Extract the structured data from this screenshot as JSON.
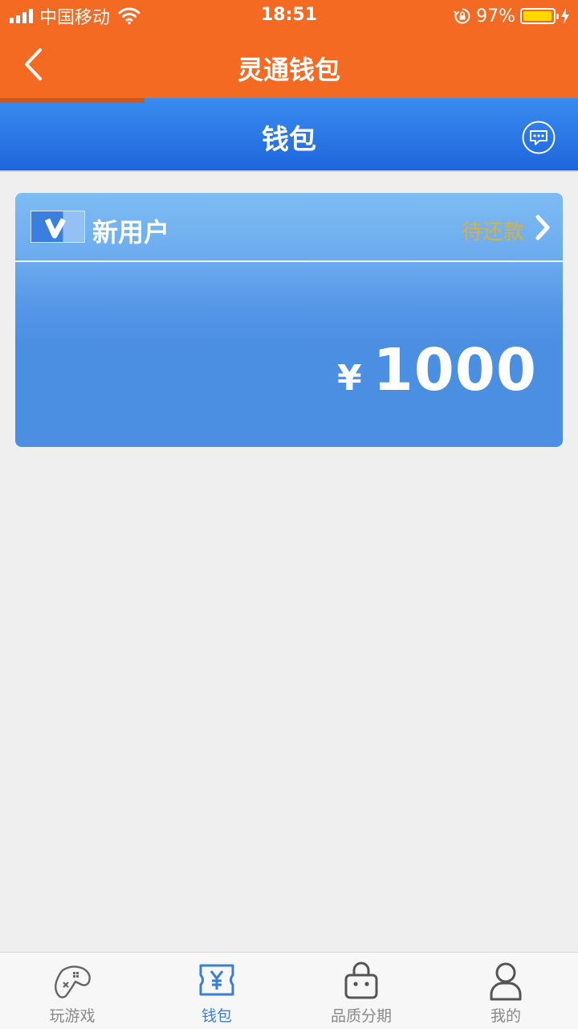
{
  "status_bar": {
    "carrier": "中国移动",
    "time": "18:51",
    "battery": "97%",
    "battery_level": 0.97
  },
  "nav": {
    "title": "灵通钱包",
    "back_icon": "chevron-left-icon"
  },
  "wallet": {
    "title": "钱包",
    "message_icon": "chat-bubble-icon"
  },
  "card": {
    "user_name": "新用户",
    "status": "待还款",
    "currency": "¥",
    "amount": "1000"
  },
  "tabs": [
    {
      "label": "玩游戏",
      "icon": "gamepad-icon",
      "active": false
    },
    {
      "label": "钱包",
      "icon": "wallet-yen-icon",
      "active": true
    },
    {
      "label": "品质分期",
      "icon": "shopping-bag-icon",
      "active": false
    },
    {
      "label": "我的",
      "icon": "user-icon",
      "active": false
    }
  ],
  "colors": {
    "nav_orange": "#f46a23",
    "header_blue": "#1e66dc",
    "card_blue": "#4b8fe3",
    "status_gold": "#d9b13a",
    "tab_active": "#3a7ed8"
  }
}
